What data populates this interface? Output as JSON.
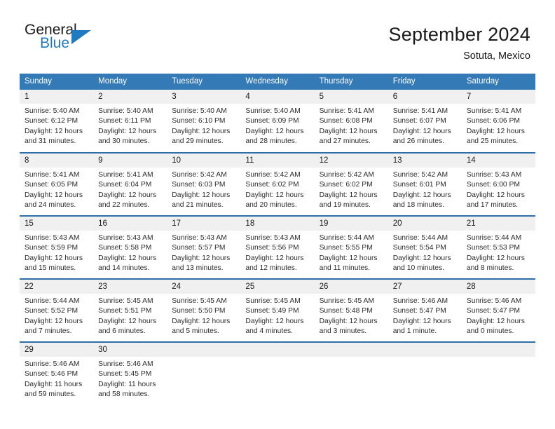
{
  "logo": {
    "text_primary": "General",
    "text_secondary": "Blue",
    "primary_color": "#1a1a1a",
    "accent_color": "#1f7ac0",
    "triangle_icon": "triangle-icon"
  },
  "header": {
    "title": "September 2024",
    "subtitle": "Sotuta, Mexico"
  },
  "theme": {
    "header_bg": "#337ab7",
    "header_text": "#ffffff",
    "row_divider": "#2f6fa8",
    "daynum_bg": "#f0f0f0",
    "body_text": "#2b2b2b"
  },
  "calendar": {
    "weekday_headers": [
      "Sunday",
      "Monday",
      "Tuesday",
      "Wednesday",
      "Thursday",
      "Friday",
      "Saturday"
    ],
    "weeks": [
      [
        {
          "day": "1",
          "sunrise": "Sunrise: 5:40 AM",
          "sunset": "Sunset: 6:12 PM",
          "daylight_line1": "Daylight: 12 hours",
          "daylight_line2": "and 31 minutes."
        },
        {
          "day": "2",
          "sunrise": "Sunrise: 5:40 AM",
          "sunset": "Sunset: 6:11 PM",
          "daylight_line1": "Daylight: 12 hours",
          "daylight_line2": "and 30 minutes."
        },
        {
          "day": "3",
          "sunrise": "Sunrise: 5:40 AM",
          "sunset": "Sunset: 6:10 PM",
          "daylight_line1": "Daylight: 12 hours",
          "daylight_line2": "and 29 minutes."
        },
        {
          "day": "4",
          "sunrise": "Sunrise: 5:40 AM",
          "sunset": "Sunset: 6:09 PM",
          "daylight_line1": "Daylight: 12 hours",
          "daylight_line2": "and 28 minutes."
        },
        {
          "day": "5",
          "sunrise": "Sunrise: 5:41 AM",
          "sunset": "Sunset: 6:08 PM",
          "daylight_line1": "Daylight: 12 hours",
          "daylight_line2": "and 27 minutes."
        },
        {
          "day": "6",
          "sunrise": "Sunrise: 5:41 AM",
          "sunset": "Sunset: 6:07 PM",
          "daylight_line1": "Daylight: 12 hours",
          "daylight_line2": "and 26 minutes."
        },
        {
          "day": "7",
          "sunrise": "Sunrise: 5:41 AM",
          "sunset": "Sunset: 6:06 PM",
          "daylight_line1": "Daylight: 12 hours",
          "daylight_line2": "and 25 minutes."
        }
      ],
      [
        {
          "day": "8",
          "sunrise": "Sunrise: 5:41 AM",
          "sunset": "Sunset: 6:05 PM",
          "daylight_line1": "Daylight: 12 hours",
          "daylight_line2": "and 24 minutes."
        },
        {
          "day": "9",
          "sunrise": "Sunrise: 5:41 AM",
          "sunset": "Sunset: 6:04 PM",
          "daylight_line1": "Daylight: 12 hours",
          "daylight_line2": "and 22 minutes."
        },
        {
          "day": "10",
          "sunrise": "Sunrise: 5:42 AM",
          "sunset": "Sunset: 6:03 PM",
          "daylight_line1": "Daylight: 12 hours",
          "daylight_line2": "and 21 minutes."
        },
        {
          "day": "11",
          "sunrise": "Sunrise: 5:42 AM",
          "sunset": "Sunset: 6:02 PM",
          "daylight_line1": "Daylight: 12 hours",
          "daylight_line2": "and 20 minutes."
        },
        {
          "day": "12",
          "sunrise": "Sunrise: 5:42 AM",
          "sunset": "Sunset: 6:02 PM",
          "daylight_line1": "Daylight: 12 hours",
          "daylight_line2": "and 19 minutes."
        },
        {
          "day": "13",
          "sunrise": "Sunrise: 5:42 AM",
          "sunset": "Sunset: 6:01 PM",
          "daylight_line1": "Daylight: 12 hours",
          "daylight_line2": "and 18 minutes."
        },
        {
          "day": "14",
          "sunrise": "Sunrise: 5:43 AM",
          "sunset": "Sunset: 6:00 PM",
          "daylight_line1": "Daylight: 12 hours",
          "daylight_line2": "and 17 minutes."
        }
      ],
      [
        {
          "day": "15",
          "sunrise": "Sunrise: 5:43 AM",
          "sunset": "Sunset: 5:59 PM",
          "daylight_line1": "Daylight: 12 hours",
          "daylight_line2": "and 15 minutes."
        },
        {
          "day": "16",
          "sunrise": "Sunrise: 5:43 AM",
          "sunset": "Sunset: 5:58 PM",
          "daylight_line1": "Daylight: 12 hours",
          "daylight_line2": "and 14 minutes."
        },
        {
          "day": "17",
          "sunrise": "Sunrise: 5:43 AM",
          "sunset": "Sunset: 5:57 PM",
          "daylight_line1": "Daylight: 12 hours",
          "daylight_line2": "and 13 minutes."
        },
        {
          "day": "18",
          "sunrise": "Sunrise: 5:43 AM",
          "sunset": "Sunset: 5:56 PM",
          "daylight_line1": "Daylight: 12 hours",
          "daylight_line2": "and 12 minutes."
        },
        {
          "day": "19",
          "sunrise": "Sunrise: 5:44 AM",
          "sunset": "Sunset: 5:55 PM",
          "daylight_line1": "Daylight: 12 hours",
          "daylight_line2": "and 11 minutes."
        },
        {
          "day": "20",
          "sunrise": "Sunrise: 5:44 AM",
          "sunset": "Sunset: 5:54 PM",
          "daylight_line1": "Daylight: 12 hours",
          "daylight_line2": "and 10 minutes."
        },
        {
          "day": "21",
          "sunrise": "Sunrise: 5:44 AM",
          "sunset": "Sunset: 5:53 PM",
          "daylight_line1": "Daylight: 12 hours",
          "daylight_line2": "and 8 minutes."
        }
      ],
      [
        {
          "day": "22",
          "sunrise": "Sunrise: 5:44 AM",
          "sunset": "Sunset: 5:52 PM",
          "daylight_line1": "Daylight: 12 hours",
          "daylight_line2": "and 7 minutes."
        },
        {
          "day": "23",
          "sunrise": "Sunrise: 5:45 AM",
          "sunset": "Sunset: 5:51 PM",
          "daylight_line1": "Daylight: 12 hours",
          "daylight_line2": "and 6 minutes."
        },
        {
          "day": "24",
          "sunrise": "Sunrise: 5:45 AM",
          "sunset": "Sunset: 5:50 PM",
          "daylight_line1": "Daylight: 12 hours",
          "daylight_line2": "and 5 minutes."
        },
        {
          "day": "25",
          "sunrise": "Sunrise: 5:45 AM",
          "sunset": "Sunset: 5:49 PM",
          "daylight_line1": "Daylight: 12 hours",
          "daylight_line2": "and 4 minutes."
        },
        {
          "day": "26",
          "sunrise": "Sunrise: 5:45 AM",
          "sunset": "Sunset: 5:48 PM",
          "daylight_line1": "Daylight: 12 hours",
          "daylight_line2": "and 3 minutes."
        },
        {
          "day": "27",
          "sunrise": "Sunrise: 5:46 AM",
          "sunset": "Sunset: 5:47 PM",
          "daylight_line1": "Daylight: 12 hours",
          "daylight_line2": "and 1 minute."
        },
        {
          "day": "28",
          "sunrise": "Sunrise: 5:46 AM",
          "sunset": "Sunset: 5:47 PM",
          "daylight_line1": "Daylight: 12 hours",
          "daylight_line2": "and 0 minutes."
        }
      ],
      [
        {
          "day": "29",
          "sunrise": "Sunrise: 5:46 AM",
          "sunset": "Sunset: 5:46 PM",
          "daylight_line1": "Daylight: 11 hours",
          "daylight_line2": "and 59 minutes."
        },
        {
          "day": "30",
          "sunrise": "Sunrise: 5:46 AM",
          "sunset": "Sunset: 5:45 PM",
          "daylight_line1": "Daylight: 11 hours",
          "daylight_line2": "and 58 minutes."
        },
        {
          "day": "",
          "sunrise": "",
          "sunset": "",
          "daylight_line1": "",
          "daylight_line2": ""
        },
        {
          "day": "",
          "sunrise": "",
          "sunset": "",
          "daylight_line1": "",
          "daylight_line2": ""
        },
        {
          "day": "",
          "sunrise": "",
          "sunset": "",
          "daylight_line1": "",
          "daylight_line2": ""
        },
        {
          "day": "",
          "sunrise": "",
          "sunset": "",
          "daylight_line1": "",
          "daylight_line2": ""
        },
        {
          "day": "",
          "sunrise": "",
          "sunset": "",
          "daylight_line1": "",
          "daylight_line2": ""
        }
      ]
    ]
  }
}
